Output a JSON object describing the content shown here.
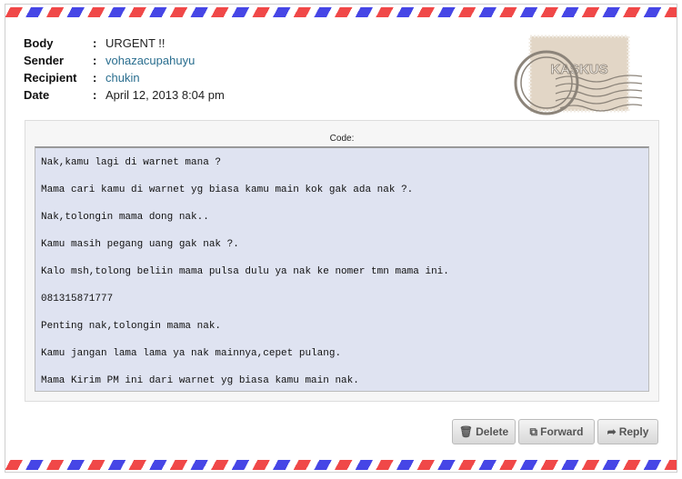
{
  "message": {
    "fields": [
      {
        "label": "Body",
        "value": "URGENT !!",
        "link": false
      },
      {
        "label": "Sender",
        "value": "vohazacupahuyu",
        "link": true
      },
      {
        "label": "Recipient",
        "value": "chukin",
        "link": true
      },
      {
        "label": "Date",
        "value": "April 12, 2013 8:04 pm",
        "link": false
      }
    ],
    "stamp_text": "KASKUS",
    "code_label": "Code:",
    "code_lines": [
      "Nak,kamu lagi di warnet mana ?",
      "Mama cari kamu di warnet yg biasa kamu main kok gak ada nak ?.",
      "Nak,tolongin mama dong nak..",
      "Kamu masih pegang uang gak nak ?.",
      "Kalo msh,tolong beliin mama pulsa dulu ya nak ke nomer tmn mama ini.",
      "081315871777",
      "Penting nak,tolongin mama nak.",
      "Kamu jangan lama lama ya nak mainnya,cepet pulang.",
      "Mama Kirim PM ini dari warnet yg biasa kamu main nak."
    ]
  },
  "buttons": {
    "delete": "Delete",
    "forward": "Forward",
    "reply": "Reply"
  },
  "colors": {
    "stripe_red": "#f04848",
    "stripe_blue": "#4646e6",
    "link": "#2a6e8f",
    "code_bg": "#dfe3f1"
  }
}
